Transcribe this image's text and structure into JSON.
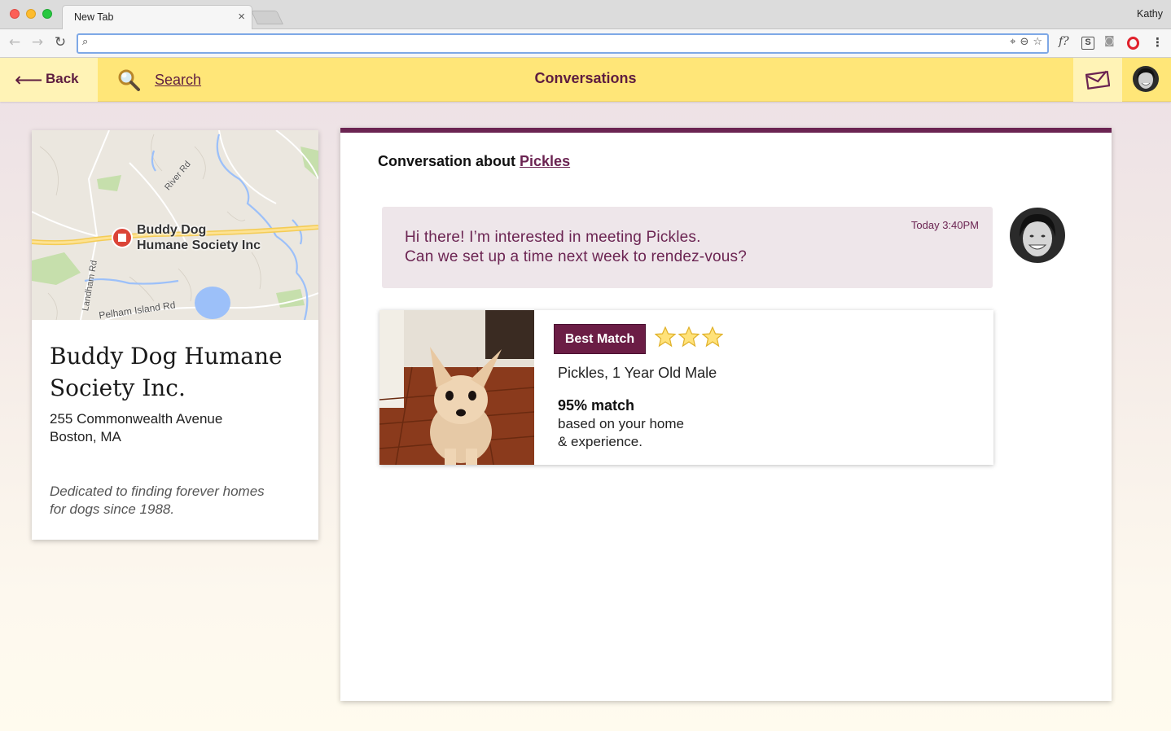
{
  "browser": {
    "tab_title": "New Tab",
    "tab_close": "×",
    "profile_name": "Kathy",
    "url_value": "",
    "nav_back": "←",
    "nav_forward": "→",
    "nav_reload": "↻",
    "omni_search_glyph": "⌕",
    "omni_icons": [
      "⌖",
      "⊖",
      "☆"
    ],
    "extensions": {
      "f_glyph": "f?",
      "s_glyph": "S",
      "camera_glyph": "◙",
      "menu_glyph": "⋮"
    }
  },
  "header": {
    "back_arrow": "⟵",
    "back_label": "Back",
    "search_label": "Search",
    "title": "Conversations"
  },
  "shelter": {
    "map_pin_label_line1": "Buddy Dog",
    "map_pin_label_line2": "Humane Society Inc",
    "map_roads": [
      "River Rd",
      "Landham Rd",
      "Pelham Island Rd"
    ],
    "name": "Buddy Dog Humane Society Inc.",
    "address_line1": "255 Commonwealth Avenue",
    "address_line2": "Boston, MA",
    "tagline_line1": "Dedicated to finding forever homes",
    "tagline_line2": "for dogs since 1988."
  },
  "conversation": {
    "header_prefix": "Conversation about",
    "pet_link": "Pickles",
    "message": {
      "time": "Today 3:40PM",
      "line1": "Hi there! I’m interested in meeting Pickles.",
      "line2": "Can we set up a time next week to rendez-vous?"
    },
    "match": {
      "badge": "Best Match",
      "stars": 3,
      "description": "Pickles, 1 Year Old Male",
      "percent": "95% match",
      "sub_line1": "based on your home",
      "sub_line2": "& experience."
    }
  },
  "colors": {
    "brand_plum": "#6b2452",
    "header_yellow": "#ffe678",
    "header_yellow_light": "#fff3b6",
    "message_bg": "#eee6ea"
  },
  "icons": [
    "back-arrow-icon",
    "magnifier-icon",
    "mail-icon",
    "user-avatar",
    "star-icon",
    "map-pin-icon"
  ]
}
